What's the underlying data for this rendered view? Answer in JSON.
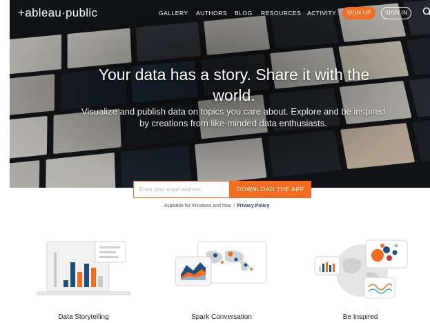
{
  "nav": {
    "logo": "+ableau·public",
    "links": [
      "GALLERY",
      "AUTHORS",
      "BLOG",
      "RESOURCES",
      "ACTIVITY"
    ],
    "signup": "SIGN UP",
    "signin": "SIGN IN"
  },
  "hero": {
    "headline": "Your data has a story. Share it with the world.",
    "subline": "Visualize and publish data on topics you care about. Explore and be inspired by creations from like-minded data enthusiasts."
  },
  "signup_form": {
    "email_placeholder": "Enter your email address",
    "download_label": "DOWNLOAD THE APP",
    "available_text": "Available for Windows and Mac",
    "separator": "|",
    "privacy_label": "Privacy Policy"
  },
  "features": [
    {
      "title": "Data Storytelling",
      "icon": "bar-chart-laptop-icon"
    },
    {
      "title": "Spark Conversation",
      "icon": "world-map-conversation-icon"
    },
    {
      "title": "Be Inspired",
      "icon": "globe-charts-icon"
    }
  ],
  "colors": {
    "accent": "#f26d21",
    "link": "#1f3b6b",
    "hero_bg": "#15181c"
  }
}
